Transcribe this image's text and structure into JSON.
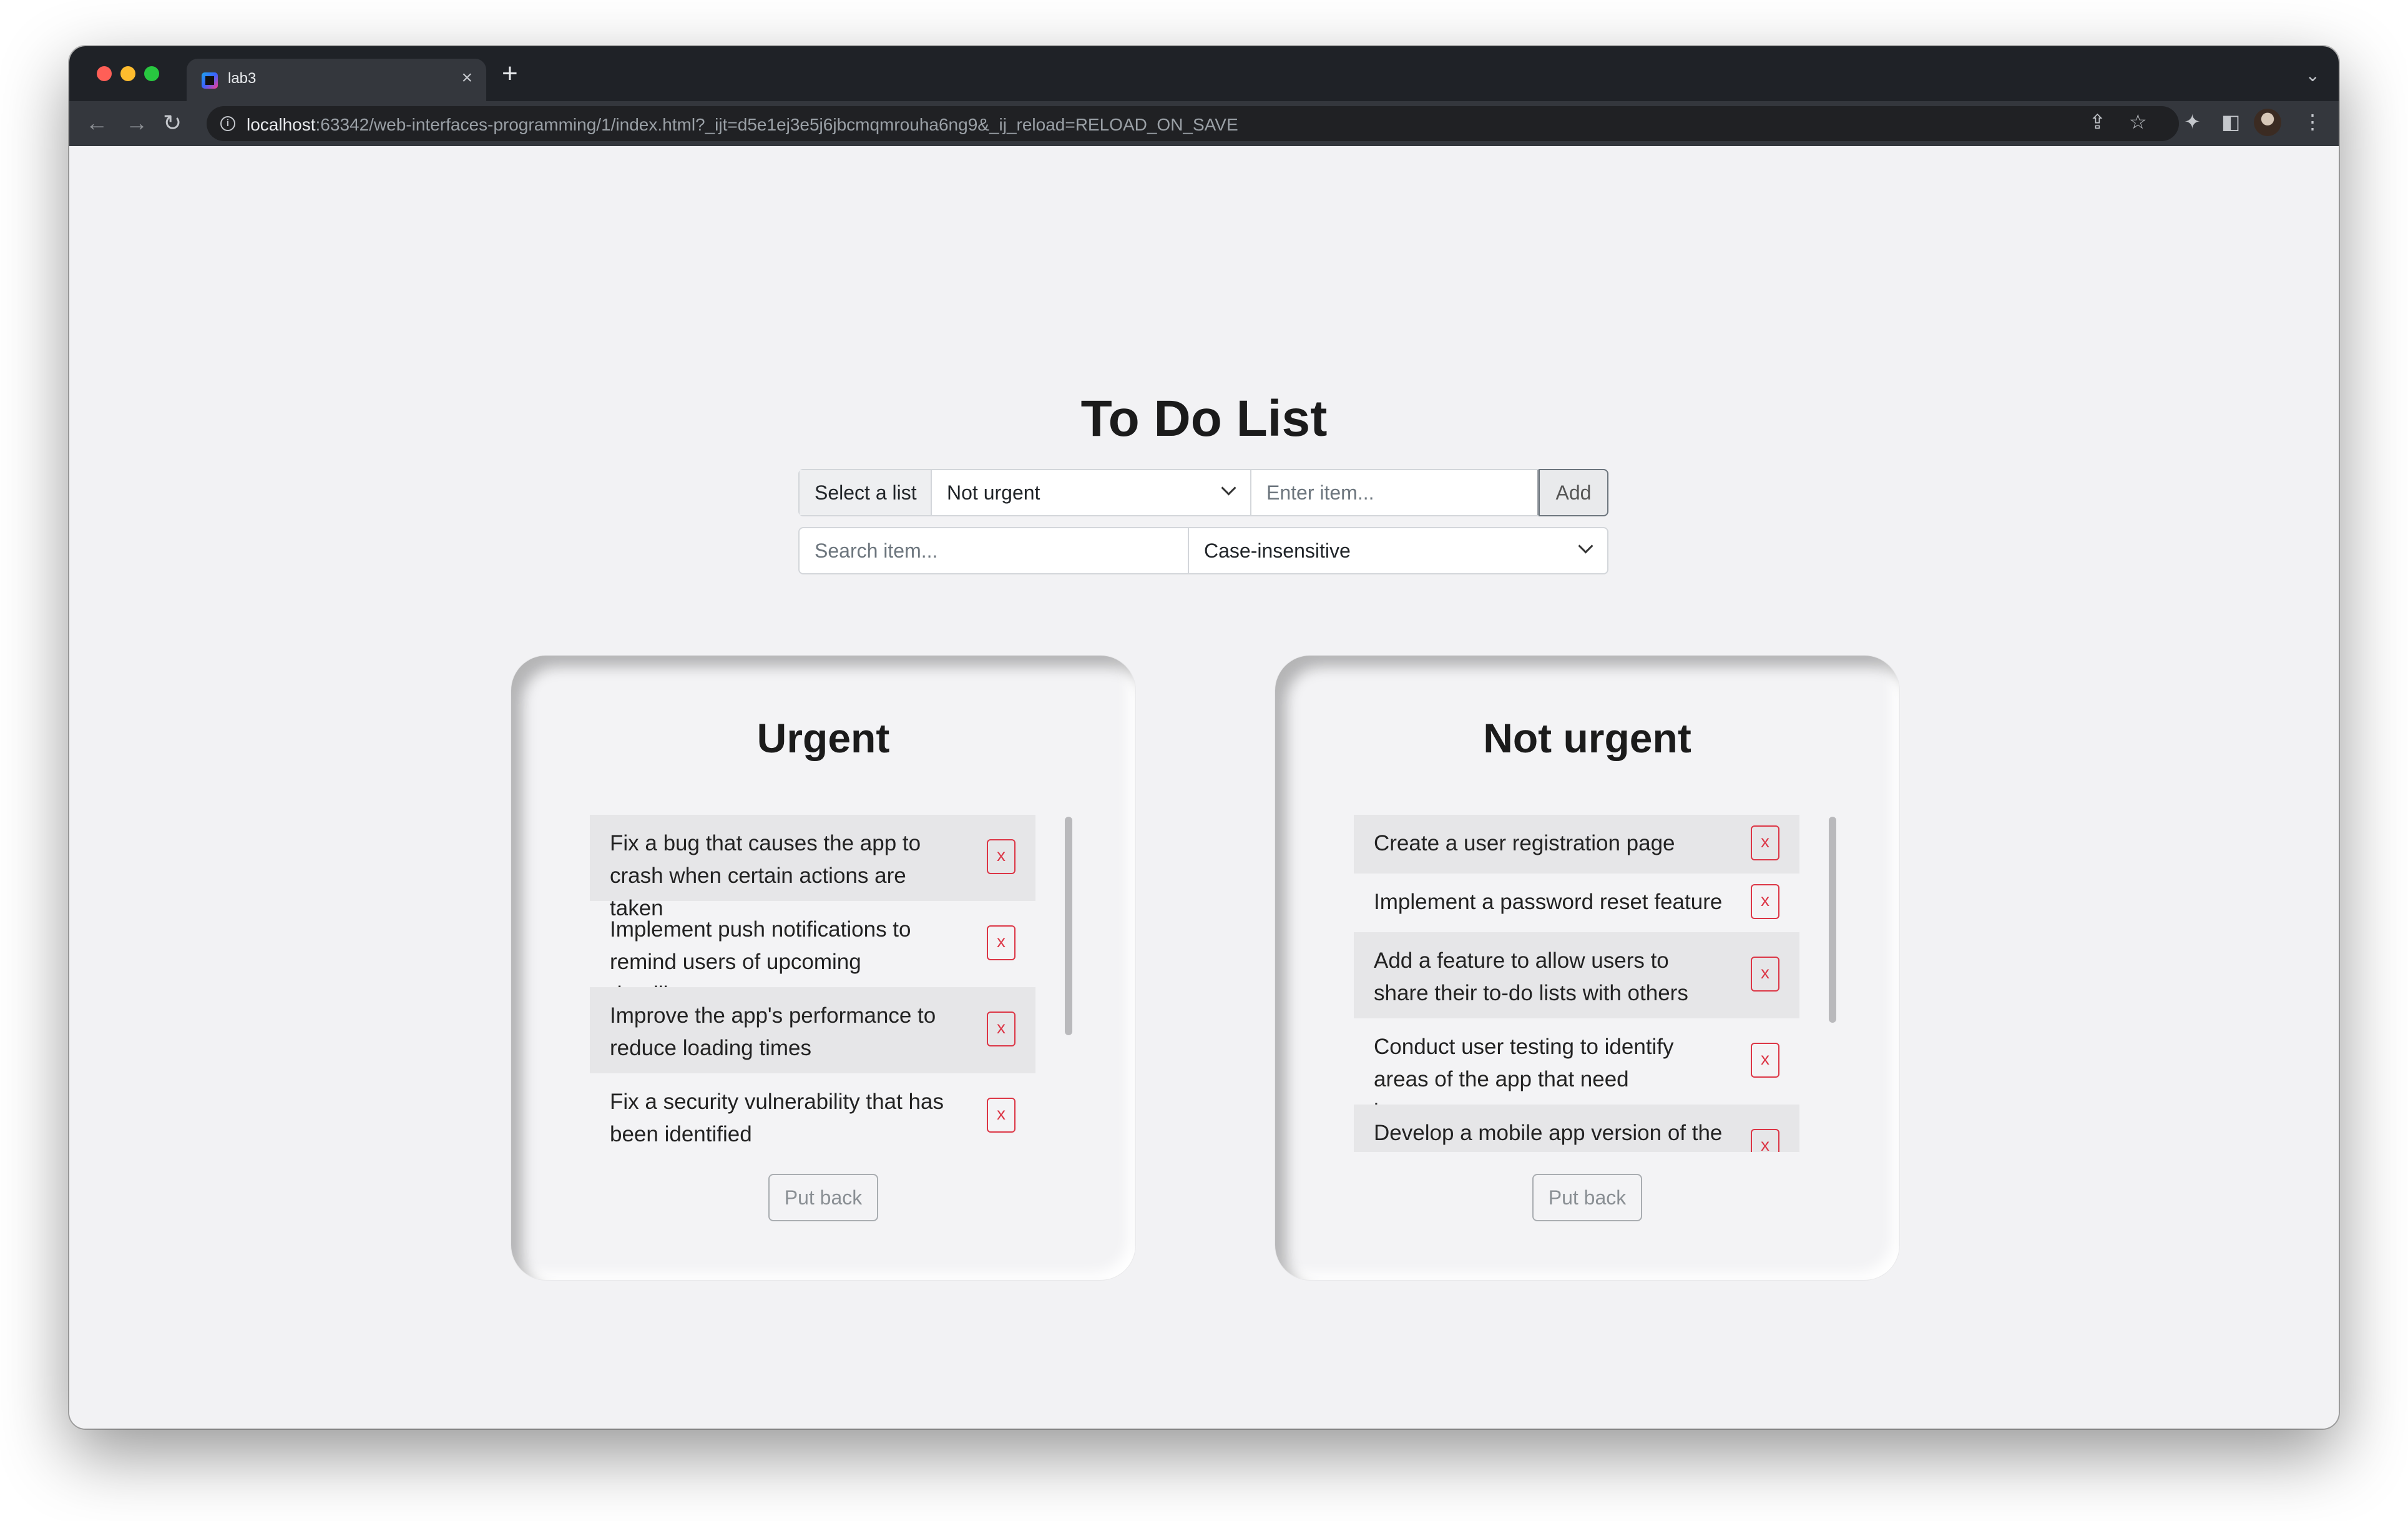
{
  "browser": {
    "tab_title": "lab3",
    "url_host": "localhost",
    "url_rest": ":63342/web-interfaces-programming/1/index.html?_ijt=d5e1ej3e5j6jbcmqmrouha6ng9&_ij_reload=RELOAD_ON_SAVE",
    "icons": [
      "back-icon",
      "forward-icon",
      "reload-icon",
      "info-icon",
      "share-icon",
      "star-icon",
      "extensions-icon",
      "side-panel-icon",
      "avatar",
      "menu-icon"
    ]
  },
  "page": {
    "title": "To Do List",
    "controls": {
      "select_label": "Select a list",
      "list_select_value": "Not urgent",
      "item_placeholder": "Enter item...",
      "add_label": "Add",
      "search_placeholder": "Search item...",
      "case_select_value": "Case-insensitive"
    },
    "lists": {
      "urgent": {
        "title": "Urgent",
        "items": [
          {
            "text": "Fix a bug that causes the app to crash when certain actions are taken"
          },
          {
            "text": "Implement push notifications to remind users of upcoming deadlines"
          },
          {
            "text": "Improve the app's performance to reduce loading times"
          },
          {
            "text": "Fix a security vulnerability that has been identified"
          }
        ],
        "delete_label": "x",
        "put_back_label": "Put back"
      },
      "not_urgent": {
        "title": "Not urgent",
        "items": [
          {
            "text": "Create a user registration page"
          },
          {
            "text": "Implement a password reset feature"
          },
          {
            "text": "Add a feature to allow users to share their to-do lists with others"
          },
          {
            "text": "Conduct user testing to identify areas of the app that need improvement"
          },
          {
            "text": "Develop a mobile app version of the"
          }
        ],
        "delete_label": "x",
        "put_back_label": "Put back"
      }
    },
    "colors": {
      "page_bg": "#f2f2f4",
      "delete_red": "#dc3545",
      "chrome_dark": "#1f2227"
    }
  }
}
